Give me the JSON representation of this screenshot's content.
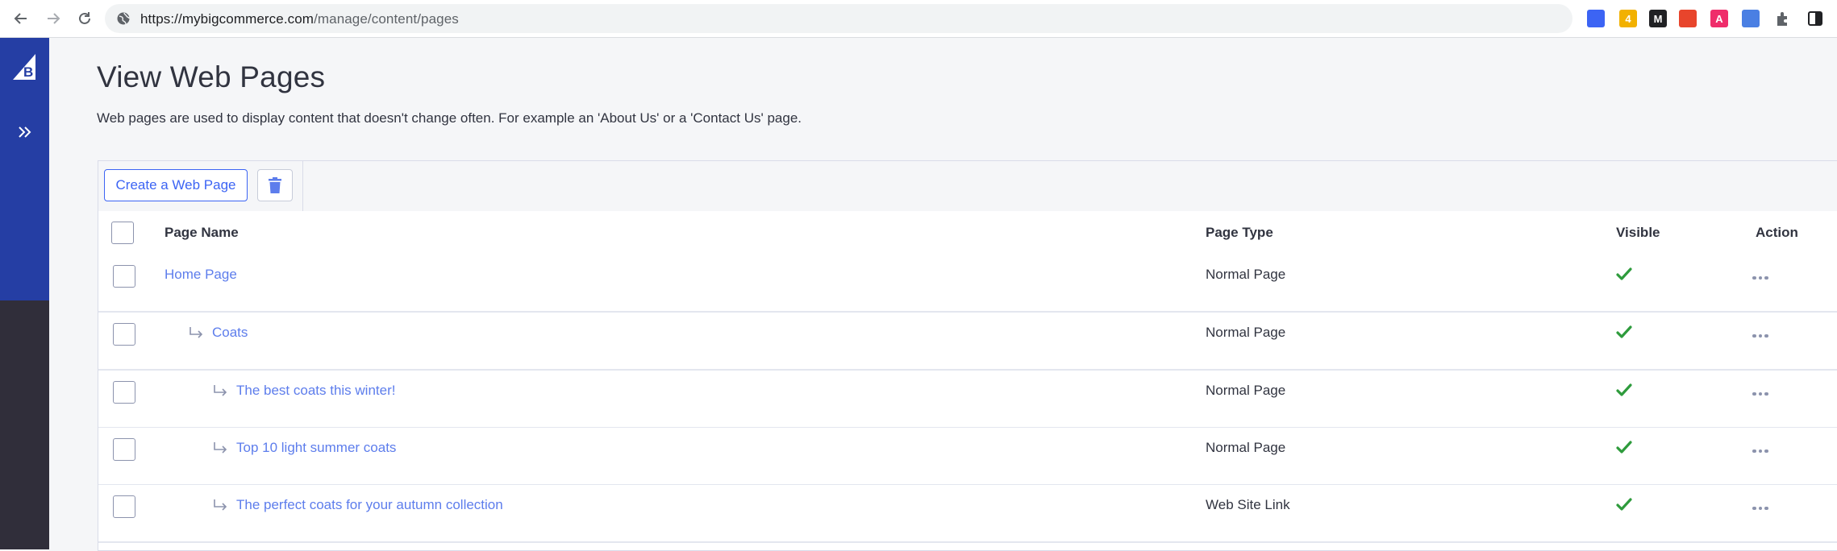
{
  "browser": {
    "url_host": "https://mybigcommerce.com",
    "url_path": "/manage/content/pages",
    "extensions": [
      {
        "name": "extension-blue-icon",
        "color": "#3c64f4",
        "label": ""
      },
      {
        "name": "extension-bulb-icon",
        "color": "#f2b100",
        "label": "4"
      },
      {
        "name": "extension-m-icon",
        "color": "#202124",
        "label": "M"
      },
      {
        "name": "extension-lock-icon",
        "color": "#e8452c",
        "label": ""
      },
      {
        "name": "extension-a-icon",
        "color": "#ef2d6b",
        "label": "A"
      },
      {
        "name": "extension-translate-icon",
        "color": "#4a7fe3",
        "label": ""
      }
    ]
  },
  "sidebar": {
    "logo_color": "#253ea4",
    "bg_color": "#302e3a"
  },
  "page": {
    "title": "View Web Pages",
    "description": "Web pages are used to display content that doesn't change often. For example an 'About Us' or a 'Contact Us' page."
  },
  "toolbar": {
    "create_label": "Create a Web Page"
  },
  "table": {
    "headers": {
      "name": "Page Name",
      "type": "Page Type",
      "visible": "Visible",
      "action": "Action"
    },
    "rows": [
      {
        "name": "Home Page",
        "level": 0,
        "type": "Normal Page",
        "visible": true
      },
      {
        "name": "Coats",
        "level": 1,
        "type": "Normal Page",
        "visible": true
      },
      {
        "name": "The best coats this winter!",
        "level": 2,
        "type": "Normal Page",
        "visible": true
      },
      {
        "name": "Top 10 light summer coats",
        "level": 2,
        "type": "Normal Page",
        "visible": true
      },
      {
        "name": "The perfect coats for your autumn collection",
        "level": 2,
        "type": "Web Site Link",
        "visible": true
      }
    ]
  },
  "colors": {
    "accent": "#3c64f4",
    "link": "#5d7dec",
    "check": "#2e9b3c"
  }
}
